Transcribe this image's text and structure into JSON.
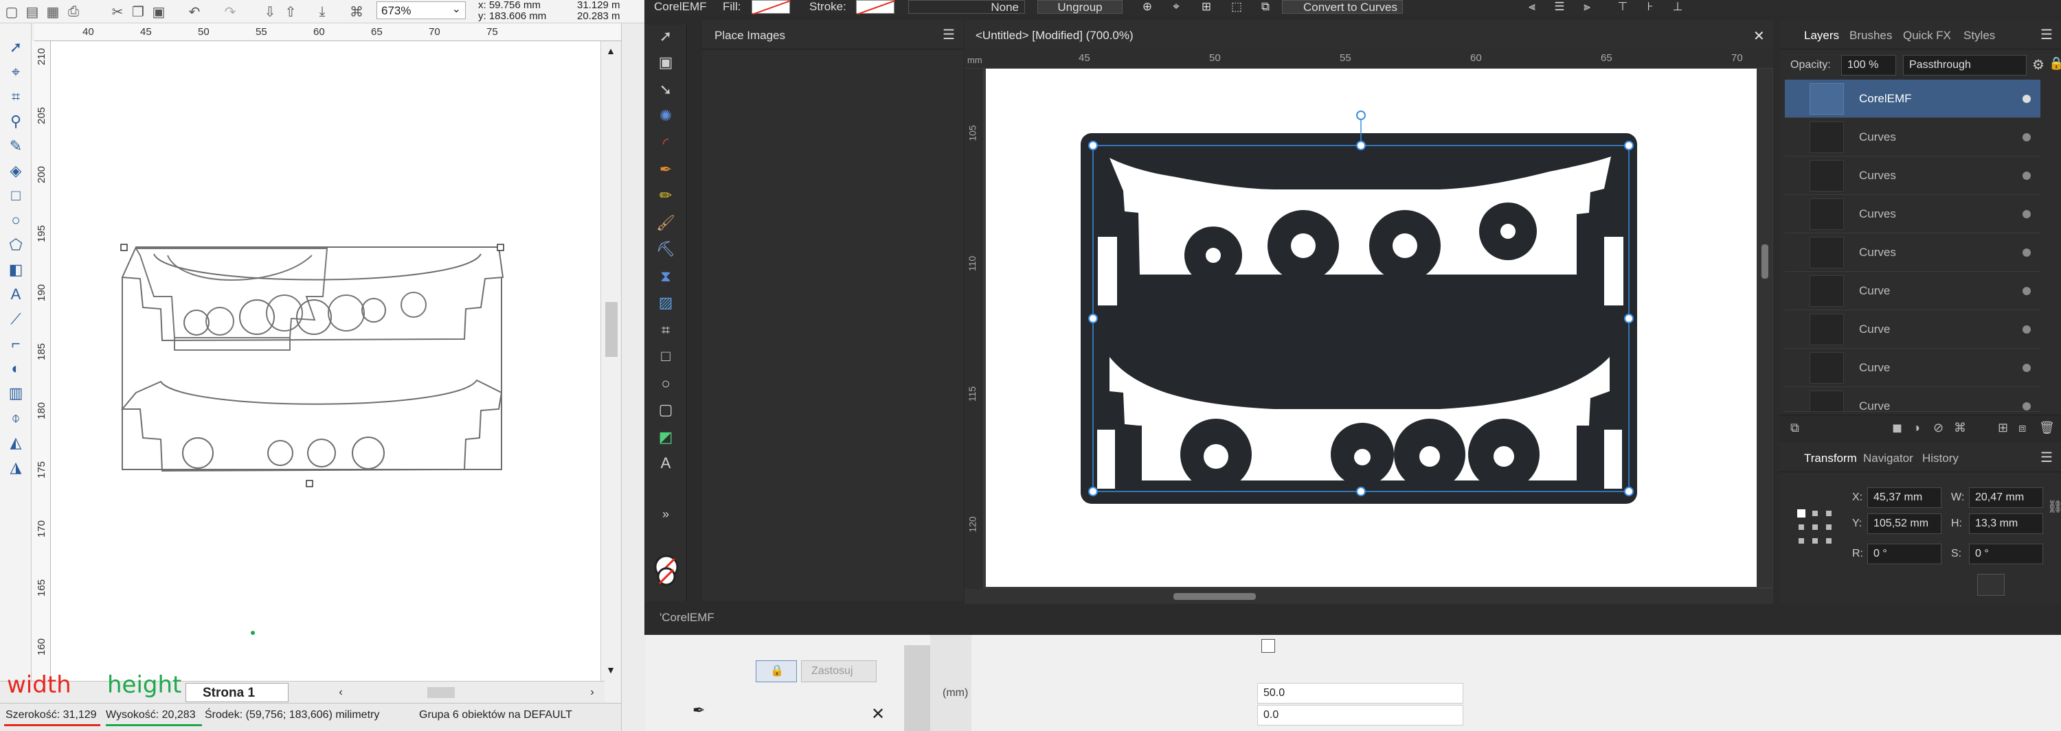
{
  "corel": {
    "toolbar": {
      "zoom_value": "673%",
      "x_value": "59.756 mm",
      "y_value": "183.606 mm",
      "w_value": "31.129 m",
      "h_value": "20.283 m",
      "units": "milimetry",
      "zoom_caret": "⌄"
    },
    "ruler_top_ticks": [
      "40",
      "45",
      "50",
      "55",
      "60",
      "65",
      "70",
      "75"
    ],
    "ruler_left_ticks": [
      "210",
      "205",
      "200",
      "195",
      "190",
      "185",
      "180",
      "175",
      "170",
      "165",
      "160"
    ],
    "page_tab": "Strona 1",
    "status": {
      "width_text": "Szerokość: 31,129",
      "height_text": "Wysokość: 20,283",
      "center_text": "Środek: (59,756; 183,606) milimetry",
      "group_text": "Grupa 6 obiektów na DEFAULT"
    },
    "annotations": {
      "width": "width",
      "height": "height"
    }
  },
  "affinity": {
    "context": {
      "name": "CorelEMF",
      "fill_label": "Fill:",
      "stroke_label": "Stroke:",
      "stroke_none": "None",
      "ungroup": "Ungroup",
      "convert": "Convert to Curves"
    },
    "place_images_title": "Place Images",
    "doc_title": "<Untitled> [Modified] (700.0%)",
    "ruler_h_units": "mm",
    "ruler_h_ticks": [
      "45",
      "50",
      "55",
      "60",
      "65",
      "70"
    ],
    "ruler_v_ticks": [
      "105",
      "110",
      "115",
      "120"
    ],
    "status_name": "'CorelEMF",
    "panels": {
      "tabs": [
        "Layers",
        "Brushes",
        "Quick FX",
        "Styles"
      ],
      "opacity_label": "Opacity:",
      "opacity_value": "100 %",
      "blend_mode": "Passthrough",
      "layers": [
        {
          "name": "CorelEMF"
        },
        {
          "name": "Curves"
        },
        {
          "name": "Curves"
        },
        {
          "name": "Curves"
        },
        {
          "name": "Curves"
        },
        {
          "name": "Curve"
        },
        {
          "name": "Curve"
        },
        {
          "name": "Curve"
        },
        {
          "name": "Curve"
        }
      ],
      "transform_tabs": [
        "Transform",
        "Navigator",
        "History"
      ],
      "transform": {
        "x_label": "X:",
        "x_value": "45,37 mm",
        "w_label": "W:",
        "w_value": "20,47 mm",
        "y_label": "Y:",
        "y_value": "105,52 mm",
        "h_label": "H:",
        "h_value": "13,3 mm",
        "r_label": "R:",
        "r_value": "0 °",
        "s_label": "S:",
        "s_value": "0 °"
      }
    }
  },
  "dialog": {
    "apply_label": "Zastosuj",
    "unit_label": "(mm)",
    "value1": "50.0",
    "value2": "0.0"
  },
  "colors": {
    "affinity_bg": "#2b2b2b",
    "selection_blue": "#3a8ee6",
    "shape_dark": "#25282c",
    "corel_blue": "#2a5d9a",
    "annotation_red": "#e8261d",
    "annotation_green": "#1fa84a"
  }
}
